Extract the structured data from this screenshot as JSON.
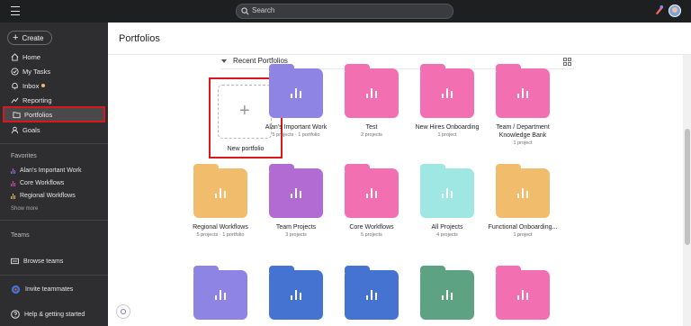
{
  "topbar": {
    "search_placeholder": "Search"
  },
  "sidebar": {
    "create_label": "Create",
    "nav": [
      {
        "label": "Home",
        "icon": "home-icon"
      },
      {
        "label": "My Tasks",
        "icon": "check-circle-icon"
      },
      {
        "label": "Inbox",
        "icon": "bell-icon",
        "has_dot": true
      },
      {
        "label": "Reporting",
        "icon": "line-chart-icon"
      },
      {
        "label": "Portfolios",
        "icon": "folder-icon",
        "active": true
      },
      {
        "label": "Goals",
        "icon": "person-icon"
      }
    ],
    "favorites_title": "Favorites",
    "favorites": [
      {
        "label": "Alan's Important Work",
        "color": "#9b6ce6"
      },
      {
        "label": "Core Workflows",
        "color": "#d94fb3"
      },
      {
        "label": "Regional Workflows",
        "color": "#f1bd6c"
      }
    ],
    "show_more": "Show more",
    "teams_title": "Teams",
    "browse_teams": "Browse teams",
    "invite": "Invite teammates",
    "help": "Help & getting started"
  },
  "main": {
    "page_title": "Portfolios",
    "recent_title": "Recent Portfolios",
    "new_portfolio_label": "New portfolio",
    "portfolios": [
      {
        "name": "Alan's Important Work",
        "meta": "5 projects · 1 portfolio",
        "color": "#8e84e3"
      },
      {
        "name": "Test",
        "meta": "2 projects",
        "color": "#f26fb2"
      },
      {
        "name": "New Hires Onboarding",
        "meta": "1 project",
        "color": "#f26fb2"
      },
      {
        "name": "Team / Department Knowledge Bank",
        "meta": "1 project",
        "color": "#f26fb2"
      },
      {
        "name": "Regional Workflows",
        "meta": "5 projects · 1 portfolio",
        "color": "#f1bd6c"
      },
      {
        "name": "Team Projects",
        "meta": "3 projects",
        "color": "#b36bd4"
      },
      {
        "name": "Core Workflows",
        "meta": "5 projects",
        "color": "#f26fb2"
      },
      {
        "name": "All Projects",
        "meta": "4 projects",
        "color": "#9ee7e3"
      },
      {
        "name": "Functional Onboarding...",
        "meta": "1 project",
        "color": "#f1bd6c"
      },
      {
        "name": "",
        "meta": "",
        "color": "#8e84e3"
      },
      {
        "name": "",
        "meta": "",
        "color": "#4573d2"
      },
      {
        "name": "",
        "meta": "",
        "color": "#4573d2"
      },
      {
        "name": "",
        "meta": "",
        "color": "#5da283"
      },
      {
        "name": "",
        "meta": "",
        "color": "#f26fb2"
      }
    ]
  }
}
